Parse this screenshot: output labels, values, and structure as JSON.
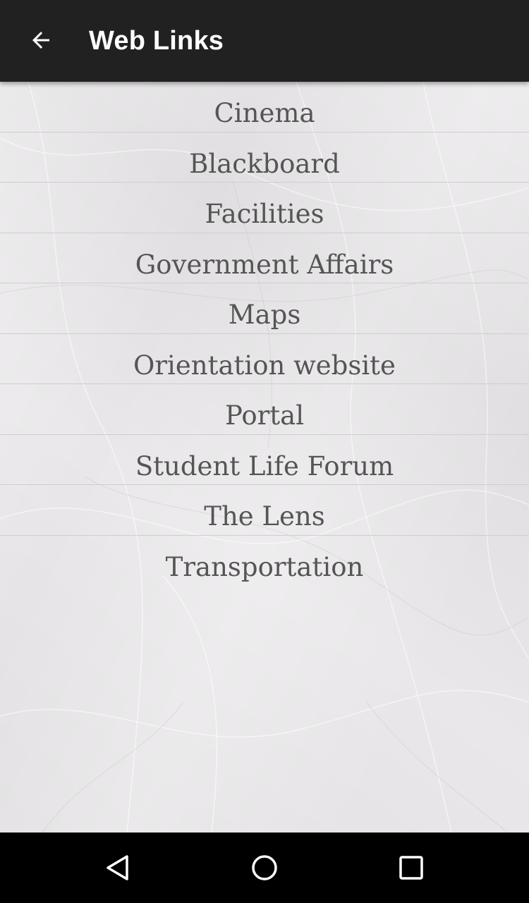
{
  "app_bar": {
    "title": "Web Links",
    "back_icon": "arrow-back-icon",
    "background": "#212121"
  },
  "links": [
    "Cinema",
    "Blackboard",
    "Facilities",
    "Government Affairs",
    "Maps",
    "Orientation website",
    "Portal",
    "Student Life Forum",
    "The Lens",
    "Transportation"
  ],
  "nav_bar": {
    "back_icon": "nav-back-triangle-icon",
    "home_icon": "nav-home-circle-icon",
    "recents_icon": "nav-recents-square-icon"
  },
  "colors": {
    "content_bg": "#e9e7e9",
    "link_text": "#555555",
    "divider": "#cfcdcf"
  }
}
